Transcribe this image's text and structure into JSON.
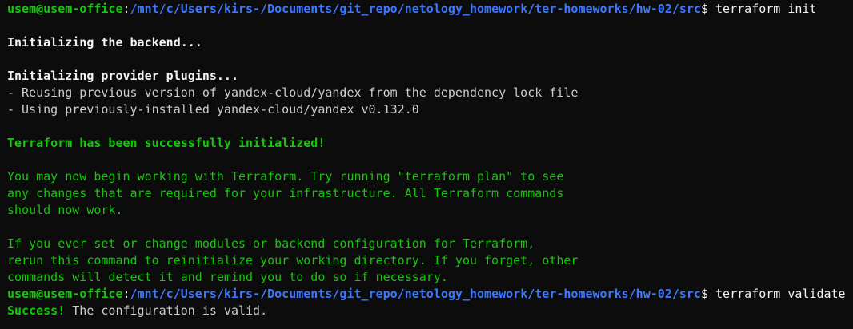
{
  "prompt1": {
    "user_host": "usem@usem-office",
    "path": "/mnt/c/Users/kirs-/Documents/git_repo/netology_homework/ter-homeworks/hw-02/src",
    "symbol": "$",
    "command": " terraform init"
  },
  "backend": "Initializing the backend...",
  "plugins": "Initializing provider plugins...",
  "reuse": "- Reusing previous version of yandex-cloud/yandex from the dependency lock file",
  "using": "- Using previously-installed yandex-cloud/yandex v0.132.0",
  "success_init": "Terraform has been successfully initialized!",
  "para1": [
    "You may now begin working with Terraform. Try running \"terraform plan\" to see",
    "any changes that are required for your infrastructure. All Terraform commands",
    "should now work."
  ],
  "para2": [
    "If you ever set or change modules or backend configuration for Terraform,",
    "rerun this command to reinitialize your working directory. If you forget, other",
    "commands will detect it and remind you to do so if necessary."
  ],
  "prompt2": {
    "user_host": "usem@usem-office",
    "path": "/mnt/c/Users/kirs-/Documents/git_repo/netology_homework/ter-homeworks/hw-02/src",
    "symbol": "$",
    "command": " terraform validate"
  },
  "validate": {
    "success": "Success!",
    "message": " The configuration is valid."
  },
  "colors": {
    "background": "#0c0c0c",
    "prompt_user": "#16c60c",
    "prompt_path": "#3b78ff",
    "output": "#cccccc",
    "success": "#16c60c"
  }
}
